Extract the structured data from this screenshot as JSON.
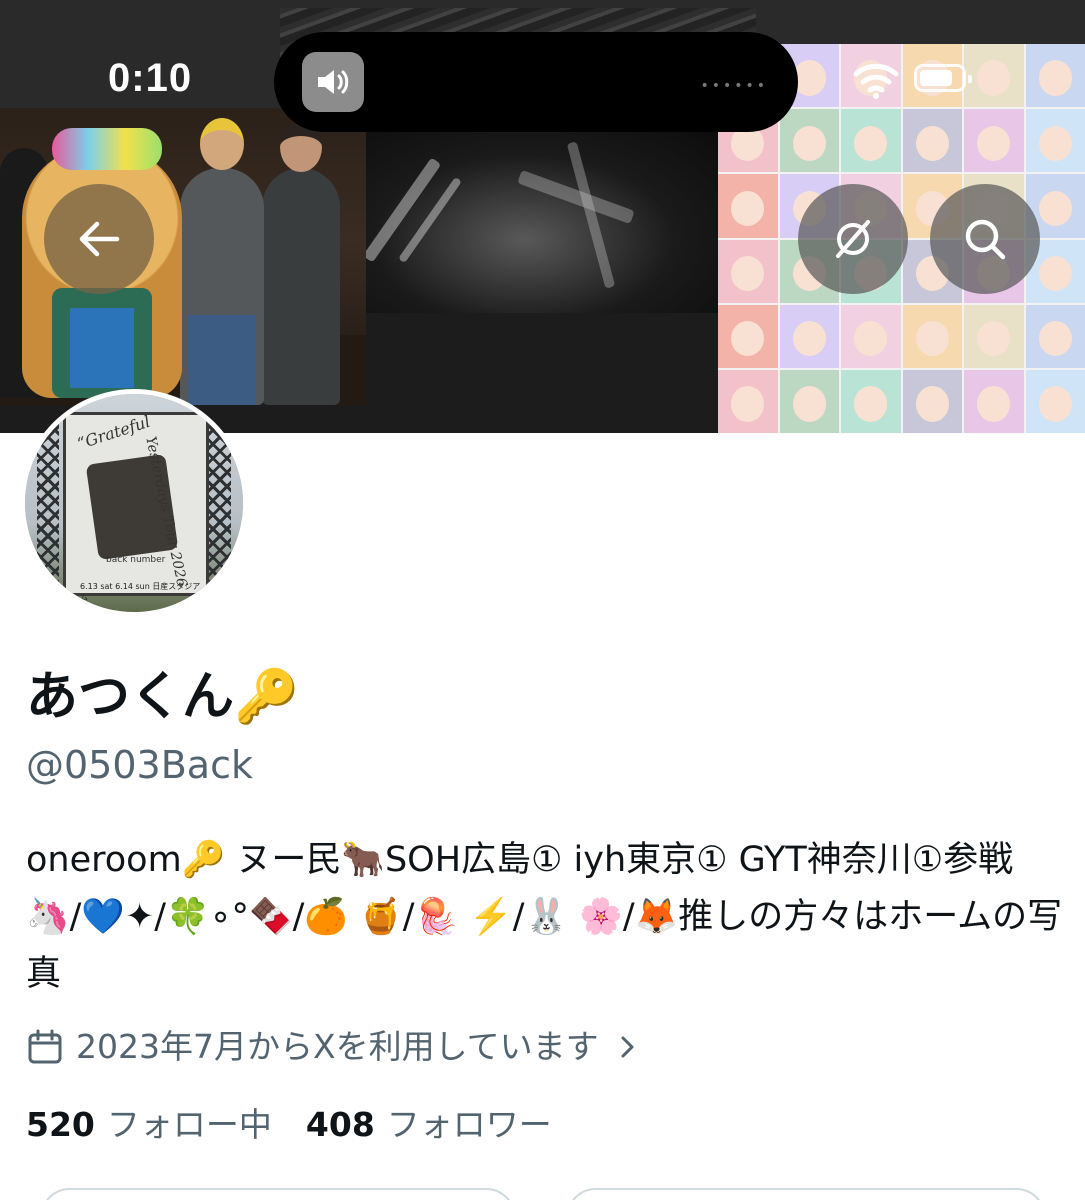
{
  "status_bar": {
    "time": "0:10",
    "icons": [
      "speaker-icon",
      "wifi-icon",
      "battery-icon"
    ],
    "battery_level": 0.8
  },
  "header": {
    "buttons": [
      "back-arrow-icon",
      "translate-icon",
      "search-icon"
    ]
  },
  "profile": {
    "display_name": "あつくん🔑",
    "handle": "@0503Back",
    "bio": "oneroom🔑 ヌー民🐂SOH広島① iyh東京① GYT神奈川①参戦 🦄/💙✦/🍀∘°🍫/🍊 🍯/🪼 ⚡️/🐰 🌸/🦊推しの方々はホームの写真",
    "joined": "2023年7月からXを利用しています",
    "following_count": "520",
    "following_label": "フォロー中",
    "followers_count": "408",
    "followers_label": "フォロワー"
  },
  "colors": {
    "text_primary": "#0f1419",
    "text_secondary": "#536471",
    "banner_bg": "#1c1c1c"
  }
}
